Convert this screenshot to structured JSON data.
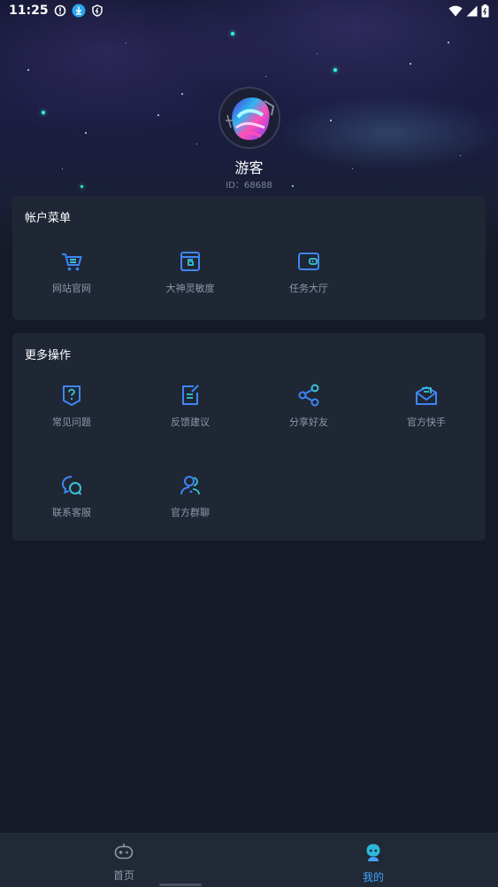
{
  "status_bar": {
    "time": "11:25",
    "left_icons": [
      "alert-circle-icon",
      "download-icon",
      "shield-icon"
    ],
    "right_icons": [
      "wifi-icon",
      "signal-icon",
      "battery-icon"
    ]
  },
  "profile": {
    "nickname": "游客",
    "id_text": "ID：68688"
  },
  "account_menu": {
    "title": "帐户菜单",
    "items": [
      {
        "label": "网站官网",
        "icon": "cart-icon"
      },
      {
        "label": "大神灵敏度",
        "icon": "browser-g-icon"
      },
      {
        "label": "任务大厅",
        "icon": "wallet-icon"
      }
    ]
  },
  "more_actions": {
    "title": "更多操作",
    "items": [
      {
        "label": "常见问题",
        "icon": "question-icon"
      },
      {
        "label": "反馈建议",
        "icon": "edit-note-icon"
      },
      {
        "label": "分享好友",
        "icon": "share-icon"
      },
      {
        "label": "官方快手",
        "icon": "mail-open-icon"
      },
      {
        "label": "联系客服",
        "icon": "chat-bubbles-icon"
      },
      {
        "label": "官方群聊",
        "icon": "group-icon"
      }
    ]
  },
  "tabbar": {
    "tabs": [
      {
        "label": "首页",
        "icon": "gamepad-icon",
        "active": false
      },
      {
        "label": "我的",
        "icon": "profile-mascot-icon",
        "active": true
      }
    ]
  },
  "colors": {
    "background": "#151b26",
    "card": "#1f2735",
    "icon_blue": "#3e86f5",
    "icon_accent": "#38c3d6",
    "tab_active": "#3fa5ff",
    "tab_inactive": "#8e97a8"
  }
}
